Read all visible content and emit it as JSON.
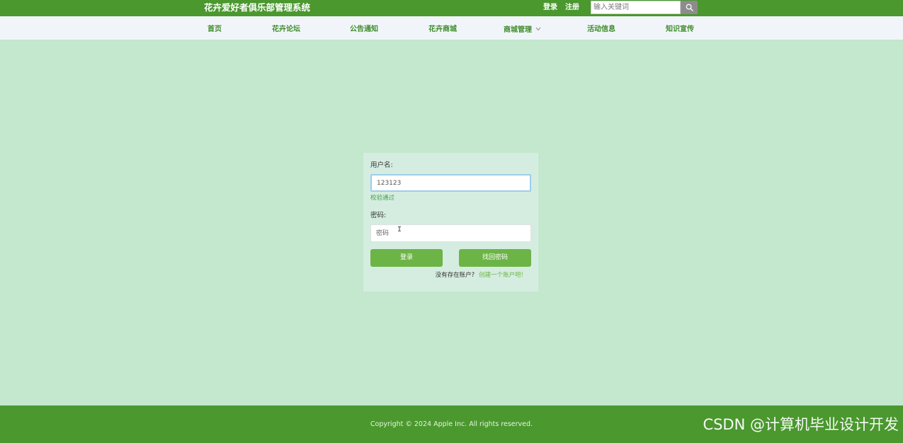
{
  "header": {
    "site_title": "花卉爱好者俱乐部管理系统",
    "login_link": "登录",
    "register_link": "注册",
    "search_placeholder": "输入关键词",
    "search_icon": "search-icon"
  },
  "nav": {
    "items": [
      {
        "label": "首页"
      },
      {
        "label": "花卉论坛"
      },
      {
        "label": "公告通知"
      },
      {
        "label": "花卉商城"
      },
      {
        "label": "商城管理",
        "icon": "chevron-down-icon"
      },
      {
        "label": "活动信息"
      },
      {
        "label": "知识宣传"
      }
    ]
  },
  "login_form": {
    "username_label": "用户名:",
    "username_value": "123123",
    "username_status": "校验通过",
    "password_label": "密码:",
    "password_placeholder": "密码",
    "login_button": "登录",
    "recover_button": "找回密码",
    "register_prompt": "没有存在账户?",
    "register_link": "创建一个账户吧!"
  },
  "footer": {
    "copyright": "Copyright © 2024 Apple Inc. All rights reserved.",
    "watermark": "CSDN @计算机毕业设计开发"
  },
  "colors": {
    "brand_green": "#4a982e",
    "nav_text": "#3e8c2b",
    "page_background": "#c3e8cd",
    "card_background": "#d5ede0",
    "button_green": "#6db446",
    "valid_text": "#44a047"
  }
}
